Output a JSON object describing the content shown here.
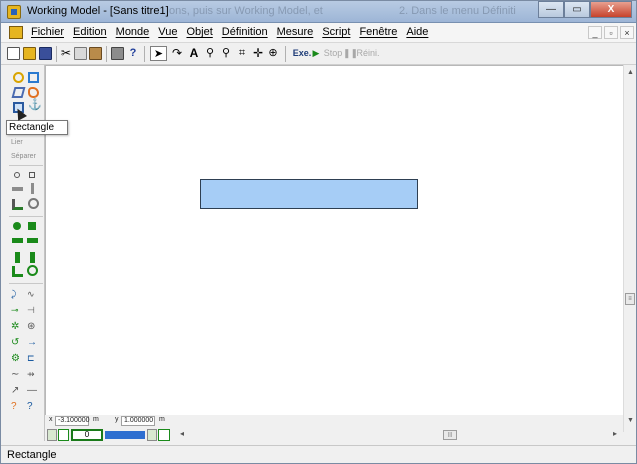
{
  "window": {
    "title": "Working Model - [Sans titre1]",
    "ghost_text_1": "ons, puis sur Working Model, et",
    "ghost_text_2": "2. Dans le menu Définiti"
  },
  "window_controls": {
    "minimize": "—",
    "maximize": "▭",
    "close": "X"
  },
  "menubar": {
    "items": [
      "Fichier",
      "Edition",
      "Monde",
      "Vue",
      "Objet",
      "Définition",
      "Mesure",
      "Script",
      "Fenêtre",
      "Aide"
    ],
    "mdi_controls": [
      "_",
      "▫",
      "×"
    ]
  },
  "toolbar": {
    "text_tool": "A",
    "run_label": "Exe.",
    "stop_label": "Stop",
    "reset_label": "Réini."
  },
  "palette": {
    "join_label": "Lier",
    "split_label": "Séparer"
  },
  "tooltip": {
    "text": "Rectangle"
  },
  "coordinates": {
    "x_label": "x",
    "x_value": "-3.100000",
    "x_unit": "m",
    "y_label": "y",
    "y_value": "1.000000",
    "y_unit": "m"
  },
  "playback": {
    "frame": "0"
  },
  "status": {
    "text": "Rectangle"
  },
  "colors": {
    "body_fill": "#a6cdf6",
    "titlebar": "#b8cbe3",
    "close_button": "#c6422b",
    "tape_blue": "#2d6fd0",
    "frame_green": "#1a7a1a"
  }
}
